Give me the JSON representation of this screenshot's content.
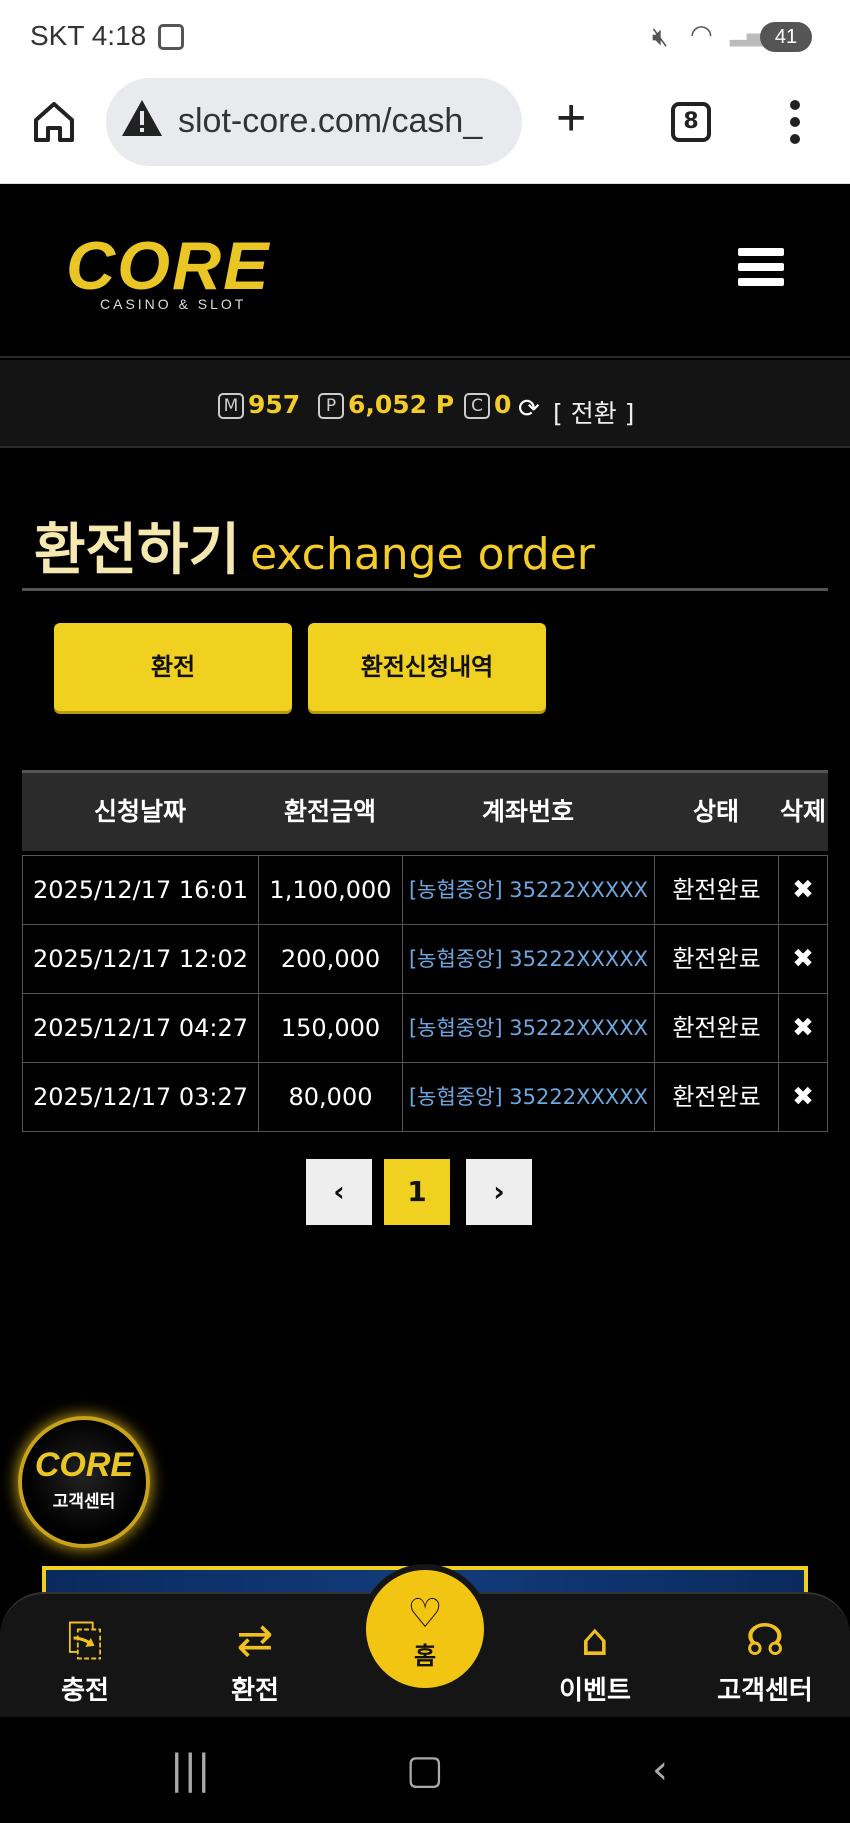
{
  "status_bar": {
    "carrier_time": "SKT 4:18",
    "battery": "41"
  },
  "browser": {
    "url": "slot-core.com/cash_",
    "tab_count": "8"
  },
  "logo": {
    "word": "CORE",
    "subtitle": "CASINO & SLOT"
  },
  "balance": {
    "money_tag": "M",
    "money": "957",
    "point_tag": "P",
    "points": "6,052 P",
    "coin_tag": "C",
    "coins": "0",
    "convert_label": "[ 전환 ]"
  },
  "page": {
    "title_ko": "환전하기",
    "title_en": "exchange order"
  },
  "tabs": {
    "exchange_label": "환전",
    "history_label": "환전신청내역"
  },
  "table": {
    "headers": {
      "date": "신청날짜",
      "amount": "환전금액",
      "account": "계좌번호",
      "status": "상태",
      "delete": "삭제"
    },
    "rows": [
      {
        "date": "2025/12/17 16:01",
        "amount": "1,100,000",
        "account": "[농협중앙] 35222XXXXX",
        "status": "환전완료",
        "delete": "✖"
      },
      {
        "date": "2025/12/17 12:02",
        "amount": "200,000",
        "account": "[농협중앙] 35222XXXXX",
        "status": "환전완료",
        "delete": "✖"
      },
      {
        "date": "2025/12/17 04:27",
        "amount": "150,000",
        "account": "[농협중앙] 35222XXXXX",
        "status": "환전완료",
        "delete": "✖"
      },
      {
        "date": "2025/12/17 03:27",
        "amount": "80,000",
        "account": "[농협중앙] 35222XXXXX",
        "status": "환전완료",
        "delete": "✖"
      }
    ]
  },
  "pagination": {
    "prev": "‹",
    "current": "1",
    "next": "›"
  },
  "cs_badge": {
    "word": "CORE",
    "label": "고객센터"
  },
  "bottom_nav": {
    "deposit": "충전",
    "withdraw": "환전",
    "home": "홈",
    "event": "이벤트",
    "support": "고객센터"
  },
  "colors": {
    "accent_yellow": "#f0d120",
    "link_blue": "#6ea7e0",
    "background": "#000000"
  }
}
